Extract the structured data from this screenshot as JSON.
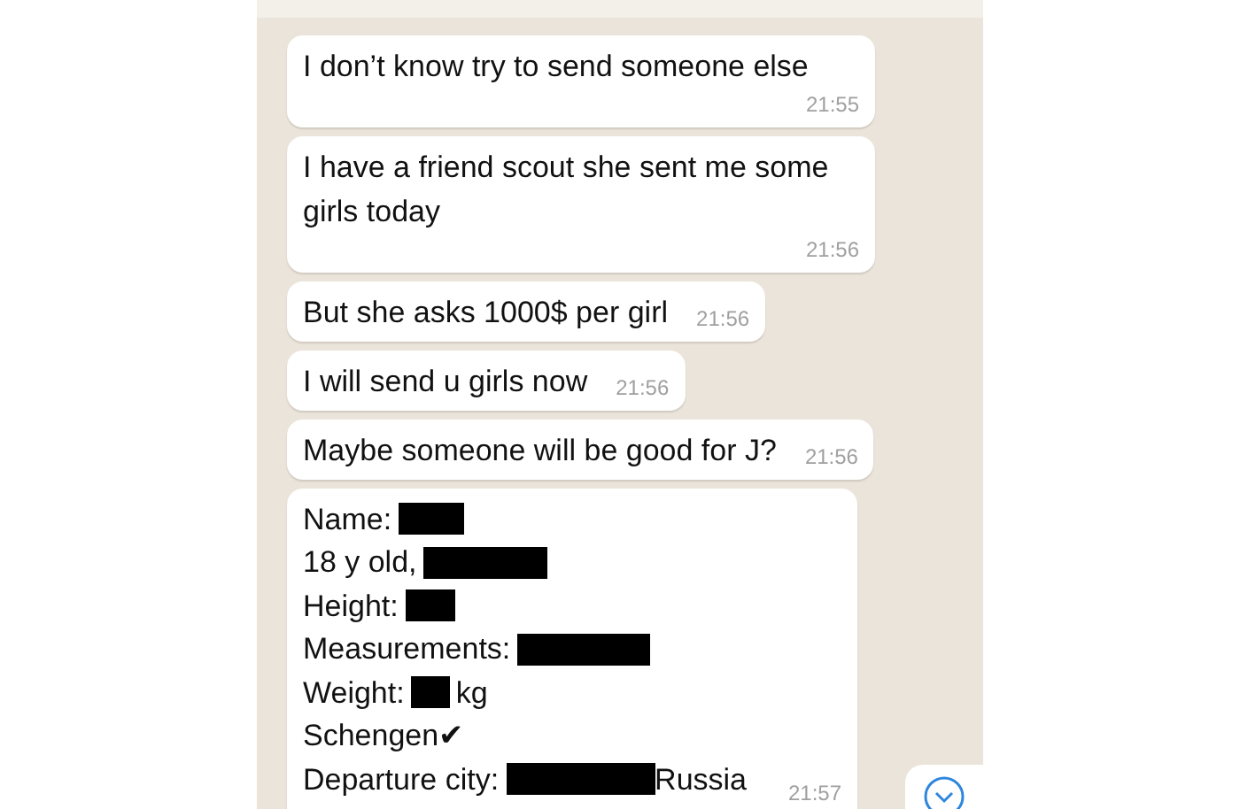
{
  "messages": [
    {
      "kind": "text",
      "text": "I don’t know try to send someone else",
      "time": "21:55"
    },
    {
      "kind": "text",
      "text": "I have a friend scout she sent me some girls today",
      "time": "21:56"
    },
    {
      "kind": "text",
      "text": "But she asks 1000$  per girl",
      "time": "21:56"
    },
    {
      "kind": "text",
      "text": "I will send u girls now",
      "time": "21:56"
    },
    {
      "kind": "text",
      "text": "Maybe someone will be good for J?",
      "time": "21:56"
    },
    {
      "kind": "form",
      "time": "21:57",
      "lines": [
        {
          "parts": [
            {
              "kind": "text",
              "text": "Name:"
            },
            {
              "kind": "redaction"
            }
          ]
        },
        {
          "parts": [
            {
              "kind": "text",
              "text": "18 y old,"
            },
            {
              "kind": "redaction"
            }
          ]
        },
        {
          "parts": [
            {
              "kind": "text",
              "text": "Height:"
            },
            {
              "kind": "redaction"
            }
          ]
        },
        {
          "parts": [
            {
              "kind": "text",
              "text": "Measurements:"
            },
            {
              "kind": "redaction"
            }
          ]
        },
        {
          "parts": [
            {
              "kind": "text",
              "text": "Weight:"
            },
            {
              "kind": "redaction"
            },
            {
              "kind": "text",
              "text": "kg"
            }
          ]
        },
        {
          "parts": [
            {
              "kind": "text",
              "text": "Schengen✔"
            }
          ]
        },
        {
          "parts": [
            {
              "kind": "text",
              "text": "Departure city:"
            },
            {
              "kind": "redaction"
            },
            {
              "kind": "text",
              "text": "Russia"
            }
          ]
        }
      ]
    }
  ]
}
